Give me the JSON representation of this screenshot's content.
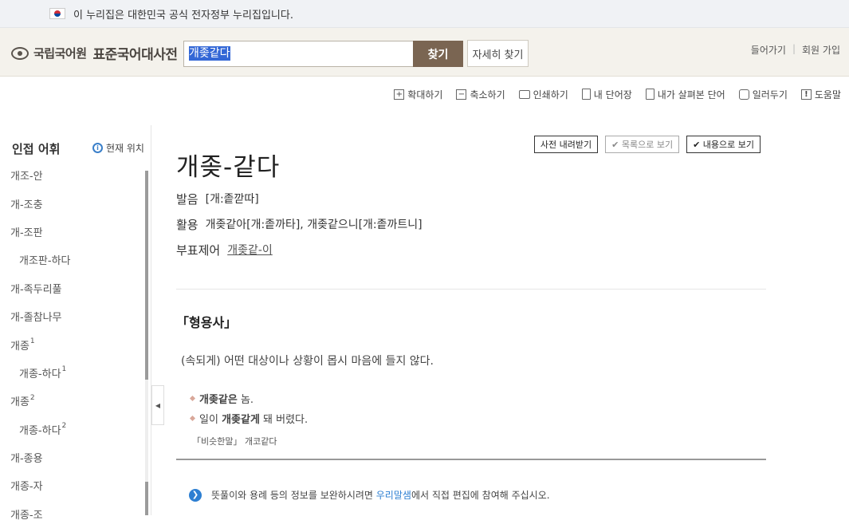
{
  "gov_banner": {
    "text": "이 누리집은 대한민국 공식 전자정부 누리집입니다."
  },
  "header": {
    "logo_small": "국립국어원",
    "logo_big": "표준국어대사전",
    "search_value": "개좆같다",
    "search_button": "찾기",
    "detail_button": "자세히 찾기",
    "login": "들어가기",
    "signup": "회원 가입"
  },
  "toolbar": {
    "items": [
      {
        "label": "확대하기",
        "icon": "plus-box-icon"
      },
      {
        "label": "축소하기",
        "icon": "minus-box-icon"
      },
      {
        "label": "인쇄하기",
        "icon": "printer-icon"
      },
      {
        "label": "내 단어장",
        "icon": "notebook-icon"
      },
      {
        "label": "내가 살펴본 단어",
        "icon": "document-icon"
      },
      {
        "label": "일러두기",
        "icon": "hand-icon"
      },
      {
        "label": "도움말",
        "icon": "exclamation-icon"
      }
    ]
  },
  "sidebar": {
    "title": "인접 어휘",
    "current_position": "현재 위치",
    "items": [
      {
        "label": "개조-안",
        "sup": ""
      },
      {
        "label": "개-조충",
        "sup": ""
      },
      {
        "label": "개-조판",
        "sup": ""
      },
      {
        "label": "개조판-하다",
        "sup": "",
        "sub": true
      },
      {
        "label": "개-족두리풀",
        "sup": ""
      },
      {
        "label": "개-졸참나무",
        "sup": ""
      },
      {
        "label": "개종",
        "sup": "1"
      },
      {
        "label": "개종-하다",
        "sup": "1",
        "sub": true
      },
      {
        "label": "개종",
        "sup": "2"
      },
      {
        "label": "개종-하다",
        "sup": "2",
        "sub": true
      },
      {
        "label": "개-종용",
        "sup": ""
      },
      {
        "label": "개종-자",
        "sup": ""
      },
      {
        "label": "개종-조",
        "sup": ""
      }
    ]
  },
  "view_buttons": {
    "download": "사전 내려받기",
    "list_view": "목록으로 보기",
    "content_view": "내용으로 보기"
  },
  "entry": {
    "word": "개좆-같다",
    "pron_label": "발음",
    "pron_value": "[개:좉깓따]",
    "conj_label": "활용",
    "conj_value": "개좆같아[개:좉까타], 개좆같으니[개:좉까트니]",
    "adv_label": "부표제어",
    "adv_value": "개좆같-이",
    "pos": "「형용사」",
    "definition": "(속되게) 어떤 대상이나 상황이 몹시 마음에 들지 않다.",
    "examples": [
      {
        "bold": "개좆같은",
        "rest": " 놈.",
        "pre": ""
      },
      {
        "pre": "일이 ",
        "bold": "개좆같게",
        "rest": " 돼 버렸다."
      }
    ],
    "synonym": "「비슷한말」 개코같다"
  },
  "notice": {
    "pre": "뜻풀이와 용례 등의 정보를 보완하시려면 ",
    "link": "우리말샘",
    "post": "에서 직접 편집에 참여해 주십시오."
  }
}
